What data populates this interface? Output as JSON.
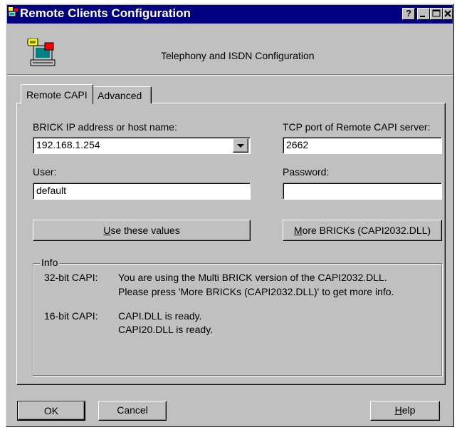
{
  "window": {
    "title": "Remote Clients Configuration",
    "header_text": "Telephony and ISDN Configuration",
    "controls": {
      "help": "?",
      "minimize": "_",
      "maximize": "□",
      "close": "×"
    }
  },
  "tabs": [
    {
      "label": "Remote CAPI",
      "active": true
    },
    {
      "label": "Advanced",
      "active": false
    }
  ],
  "form": {
    "host_label": "BRICK IP address or host name:",
    "host_value": "192.168.1.254",
    "port_label": "TCP port of Remote CAPI server:",
    "port_value": "2662",
    "user_label": "User:",
    "user_value": "default",
    "password_label": "Password:",
    "password_value": ""
  },
  "buttons": {
    "use_values": {
      "underline": "U",
      "rest": "se these values"
    },
    "more_bricks": {
      "underline": "M",
      "rest": "ore BRICKs (CAPI2032.DLL)"
    },
    "ok": "OK",
    "cancel": "Cancel",
    "help": {
      "underline": "H",
      "rest": "elp"
    }
  },
  "info": {
    "title": "Info",
    "capi32_label": "32-bit CAPI:",
    "capi32_line1": "You are using the Multi BRICK version of the CAPI2032.DLL.",
    "capi32_line2": "Please press 'More BRICKs (CAPI2032.DLL)' to get more info.",
    "capi16_label": "16-bit CAPI:",
    "capi16_line1": "CAPI.DLL is ready.",
    "capi16_line2": "CAPI20.DLL is ready."
  },
  "colors": {
    "title_bar": "#000080",
    "face": "#c0c0c0"
  }
}
